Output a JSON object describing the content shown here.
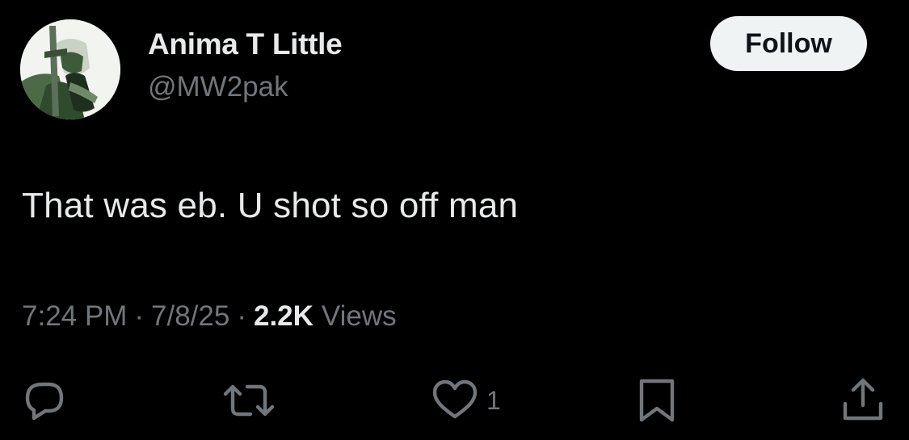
{
  "author": {
    "display_name": "Anima T Little",
    "handle": "@MW2pak",
    "avatar_icon": "profile-photo"
  },
  "follow_button": {
    "label": "Follow",
    "bg_color": "#eff3f4",
    "text_color": "#0f1419"
  },
  "tweet": {
    "text": "That was eb. U shot so off man"
  },
  "meta": {
    "time": "7:24 PM",
    "separator": "·",
    "date": "7/8/25",
    "views_count": "2.2K",
    "views_label": "Views"
  },
  "actions": {
    "reply_icon": "reply-icon",
    "retweet_icon": "retweet-icon",
    "like_icon": "heart-icon",
    "like_count": "1",
    "bookmark_icon": "bookmark-icon",
    "share_icon": "share-icon"
  },
  "colors": {
    "background": "#000000",
    "primary_text": "#e7e9ea",
    "secondary_text": "#71767b"
  }
}
